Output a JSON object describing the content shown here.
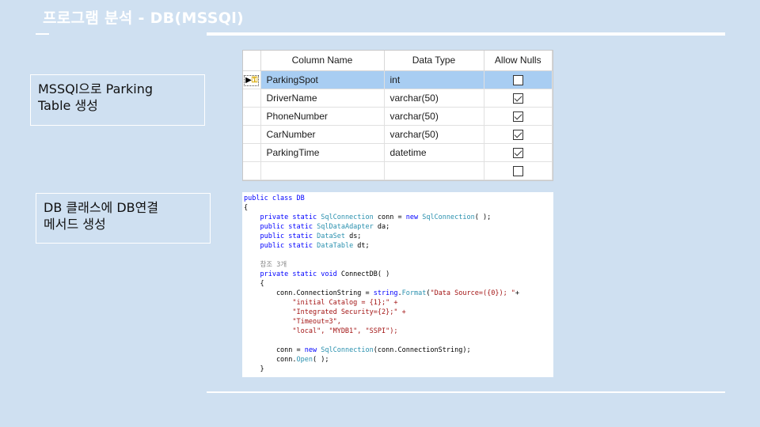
{
  "slide": {
    "title": "프로그램 분석 - DB(MSSQl)"
  },
  "captions": {
    "first_line1": "MSSQl으로 Parking",
    "first_line2": "Table 생성",
    "second_line1": "DB 클래스에 DB연결",
    "second_line2": "메서드 생성"
  },
  "designer": {
    "headers": [
      "Column Name",
      "Data Type",
      "Allow Nulls"
    ],
    "rows": [
      {
        "name": "ParkingSpot",
        "type": "int",
        "allow_nulls": false
      },
      {
        "name": "DriverName",
        "type": "varchar(50)",
        "allow_nulls": true
      },
      {
        "name": "PhoneNumber",
        "type": "varchar(50)",
        "allow_nulls": true
      },
      {
        "name": "CarNumber",
        "type": "varchar(50)",
        "allow_nulls": true
      },
      {
        "name": "ParkingTime",
        "type": "datetime",
        "allow_nulls": true
      },
      {
        "name": "",
        "type": "",
        "allow_nulls": false
      }
    ],
    "selected_row": 0,
    "key_icon": "primary-key-icon",
    "selection_color": "#a8cdf2"
  },
  "code": {
    "l1": "public class DB",
    "l2": "{",
    "l3a": "    private static ",
    "l3b": "SqlConnection",
    "l3c": " conn = ",
    "l3d": "new",
    "l3e": " ",
    "l3f": "SqlConnection",
    "l3g": "( );",
    "l4a": "    public static ",
    "l4b": "SqlDataAdapter",
    "l4c": " da;",
    "l5a": "    public static ",
    "l5b": "DataSet",
    "l5c": " ds;",
    "l6a": "    public static ",
    "l6b": "DataTable",
    "l6c": " dt;",
    "l7": "",
    "l8": "    참조 3개",
    "l9a": "    private static void ",
    "l9b": "ConnectDB( )",
    "l10": "    {",
    "l11a": "        conn.ConnectionString = ",
    "l11b": "string",
    "l11c": ".",
    "l11d": "Format",
    "l11e": "(",
    "l11f": "\"Data Source=({0}); \"",
    "l11g": "+",
    "l12": "            \"initial Catalog = {1};\" +",
    "l13": "            \"Integrated Security={2};\" +",
    "l14": "            \"Timeout=3\",",
    "l15": "            \"local\", \"MYDB1\", \"SSPI\");",
    "l16": "",
    "l17a": "        conn = ",
    "l17b": "new",
    "l17c": " ",
    "l17d": "SqlConnection",
    "l17e": "(conn.ConnectionString);",
    "l18a": "        conn.",
    "l18b": "Open",
    "l18c": "( );",
    "l19": "    }"
  },
  "colors": {
    "background": "#cfe0f1",
    "keyword": "#0000ff",
    "type": "#2b91af",
    "string": "#a31515"
  }
}
